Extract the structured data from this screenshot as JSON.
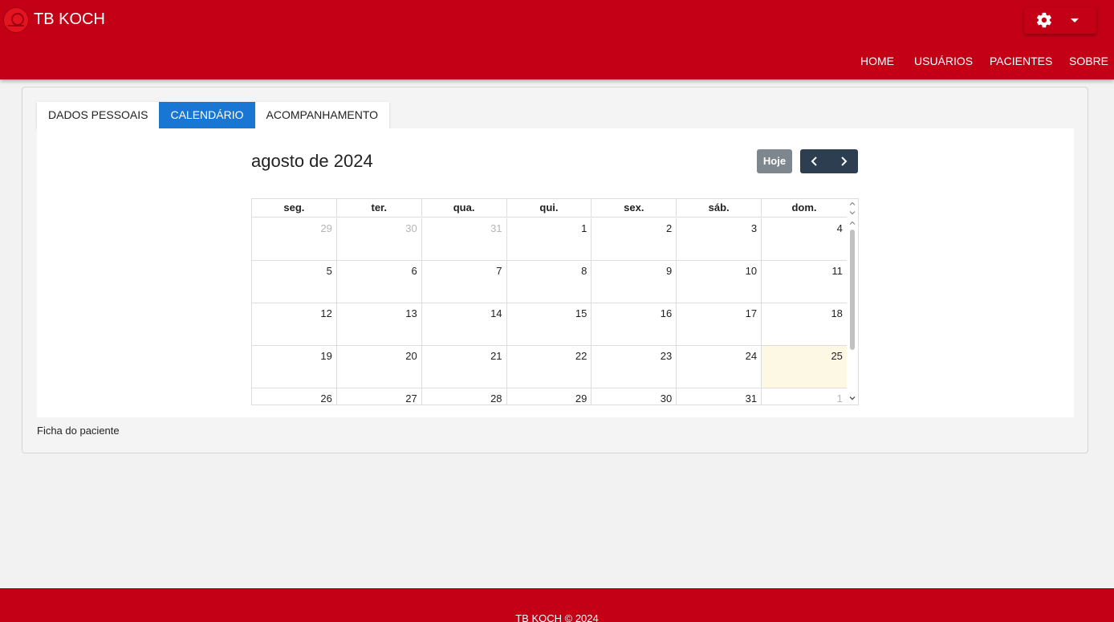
{
  "brand": {
    "name": "TB KOCH",
    "color": "#c40016"
  },
  "header": {
    "settings_icon": "gear-icon",
    "dropdown_icon": "caret-down-icon",
    "nav": [
      "HOME",
      "USUÁRIOS",
      "PACIENTES",
      "SOBRE"
    ]
  },
  "tabs": [
    {
      "label": "DADOS PESSOAIS",
      "active": false
    },
    {
      "label": "CALENDÁRIO",
      "active": true
    },
    {
      "label": "ACOMPANHAMENTO",
      "active": false
    }
  ],
  "calendar": {
    "title": "agosto de 2024",
    "today_button": "Hoje",
    "prev_icon": "chevron-left-icon",
    "next_icon": "chevron-right-icon",
    "weekdays": [
      "seg.",
      "ter.",
      "qua.",
      "qui.",
      "sex.",
      "sáb.",
      "dom."
    ],
    "weeks": [
      [
        "29",
        "30",
        "31",
        "1",
        "2",
        "3",
        "4"
      ],
      [
        "5",
        "6",
        "7",
        "8",
        "9",
        "10",
        "11"
      ],
      [
        "12",
        "13",
        "14",
        "15",
        "16",
        "17",
        "18"
      ],
      [
        "19",
        "20",
        "21",
        "22",
        "23",
        "24",
        "25"
      ],
      [
        "26",
        "27",
        "28",
        "29",
        "30",
        "31",
        "1"
      ]
    ],
    "today": "25",
    "today_color": "#fcf8e3"
  },
  "panel": {
    "caption": "Ficha do paciente"
  },
  "footer": {
    "text": "TB KOCH © 2024"
  }
}
